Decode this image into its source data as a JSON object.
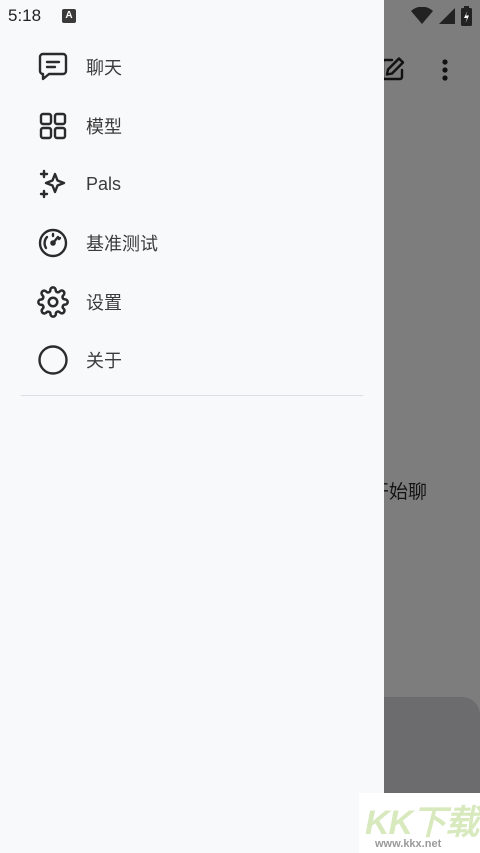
{
  "status_bar": {
    "time": "5:18",
    "notification_badge": "A"
  },
  "background": {
    "empty_chat_text": "开始聊"
  },
  "drawer": {
    "items": [
      {
        "label": "聊天",
        "icon": "chat-icon"
      },
      {
        "label": "模型",
        "icon": "grid-icon"
      },
      {
        "label": "Pals",
        "icon": "sparkles-icon"
      },
      {
        "label": "基准测试",
        "icon": "speedometer-icon"
      },
      {
        "label": "设置",
        "icon": "gear-icon"
      },
      {
        "label": "关于",
        "icon": "circle-icon"
      }
    ]
  },
  "watermark": {
    "logo": "KK下载",
    "url": "www.kkx.net"
  },
  "colors": {
    "drawer_bg": "#f8f9fb",
    "scrim": "rgba(0,0,0,0.5)",
    "icon": "#2b2b2b"
  }
}
